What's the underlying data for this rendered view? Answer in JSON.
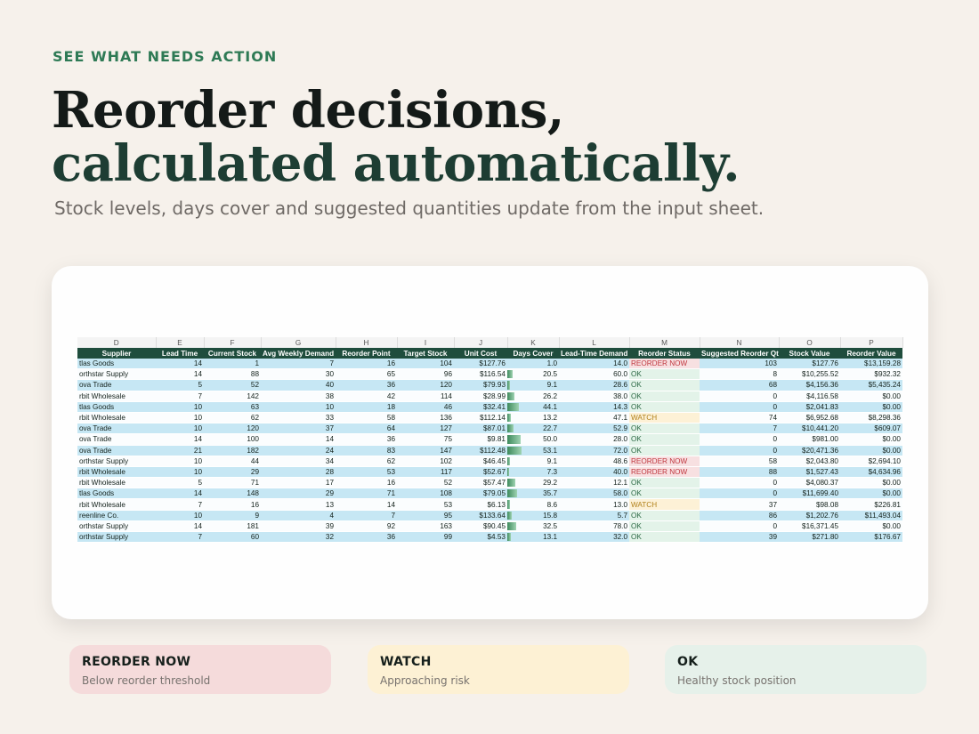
{
  "eyebrow": "SEE WHAT NEEDS ACTION",
  "headline": {
    "line1": "Reorder decisions,",
    "line2": "calculated automatically."
  },
  "subtitle": "Stock levels, days cover and suggested quantities update from the input sheet.",
  "colors": {
    "accent": "#2e7a55",
    "header_bg": "#1f4d3d",
    "row_blue": "#c6e7f4",
    "reorder": "#c0373f",
    "watch": "#b2821c",
    "ok": "#2d6a45"
  },
  "sheet": {
    "column_letters": [
      "D",
      "E",
      "F",
      "G",
      "H",
      "I",
      "J",
      "K",
      "L",
      "M",
      "N",
      "O",
      "P"
    ],
    "headers": [
      "Supplier",
      "Lead Time",
      "Current Stock",
      "Avg Weekly Demand",
      "Reorder Point",
      "Target Stock",
      "Unit Cost",
      "Days Cover",
      "Lead-Time Demand",
      "Reorder Status",
      "Suggested Reorder Qty",
      "Stock Value",
      "Reorder Value"
    ],
    "rows": [
      {
        "supplier": "tlas Goods",
        "lead": "14",
        "stock": "1",
        "demand": "7",
        "rop": "16",
        "target": "104",
        "cost": "$127.76",
        "cover": "1.0",
        "cover_pct": 0.02,
        "ltd": "14.0",
        "status": "REORDER NOW",
        "kind": "reorder",
        "qty": "103",
        "sval": "$127.76",
        "rval": "$13,159.28"
      },
      {
        "supplier": "orthstar Supply",
        "lead": "14",
        "stock": "88",
        "demand": "30",
        "rop": "65",
        "target": "96",
        "cost": "$116.54",
        "cover": "20.5",
        "cover_pct": 0.39,
        "ltd": "60.0",
        "status": "OK",
        "kind": "ok",
        "qty": "8",
        "sval": "$10,255.52",
        "rval": "$932.32"
      },
      {
        "supplier": "ova Trade",
        "lead": "5",
        "stock": "52",
        "demand": "40",
        "rop": "36",
        "target": "120",
        "cost": "$79.93",
        "cover": "9.1",
        "cover_pct": 0.17,
        "ltd": "28.6",
        "status": "OK",
        "kind": "ok",
        "qty": "68",
        "sval": "$4,156.36",
        "rval": "$5,435.24"
      },
      {
        "supplier": "rbit Wholesale",
        "lead": "7",
        "stock": "142",
        "demand": "38",
        "rop": "42",
        "target": "114",
        "cost": "$28.99",
        "cover": "26.2",
        "cover_pct": 0.49,
        "ltd": "38.0",
        "status": "OK",
        "kind": "ok",
        "qty": "0",
        "sval": "$4,116.58",
        "rval": "$0.00"
      },
      {
        "supplier": "tlas Goods",
        "lead": "10",
        "stock": "63",
        "demand": "10",
        "rop": "18",
        "target": "46",
        "cost": "$32.41",
        "cover": "44.1",
        "cover_pct": 0.83,
        "ltd": "14.3",
        "status": "OK",
        "kind": "ok",
        "qty": "0",
        "sval": "$2,041.83",
        "rval": "$0.00"
      },
      {
        "supplier": "rbit Wholesale",
        "lead": "10",
        "stock": "62",
        "demand": "33",
        "rop": "58",
        "target": "136",
        "cost": "$112.14",
        "cover": "13.2",
        "cover_pct": 0.25,
        "ltd": "47.1",
        "status": "WATCH",
        "kind": "watch",
        "qty": "74",
        "sval": "$6,952.68",
        "rval": "$8,298.36"
      },
      {
        "supplier": "ova Trade",
        "lead": "10",
        "stock": "120",
        "demand": "37",
        "rop": "64",
        "target": "127",
        "cost": "$87.01",
        "cover": "22.7",
        "cover_pct": 0.43,
        "ltd": "52.9",
        "status": "OK",
        "kind": "ok",
        "qty": "7",
        "sval": "$10,441.20",
        "rval": "$609.07"
      },
      {
        "supplier": "ova Trade",
        "lead": "14",
        "stock": "100",
        "demand": "14",
        "rop": "36",
        "target": "75",
        "cost": "$9.81",
        "cover": "50.0",
        "cover_pct": 0.94,
        "ltd": "28.0",
        "status": "OK",
        "kind": "ok",
        "qty": "0",
        "sval": "$981.00",
        "rval": "$0.00"
      },
      {
        "supplier": "ova Trade",
        "lead": "21",
        "stock": "182",
        "demand": "24",
        "rop": "83",
        "target": "147",
        "cost": "$112.48",
        "cover": "53.1",
        "cover_pct": 1.0,
        "ltd": "72.0",
        "status": "OK",
        "kind": "ok",
        "qty": "0",
        "sval": "$20,471.36",
        "rval": "$0.00"
      },
      {
        "supplier": "orthstar Supply",
        "lead": "10",
        "stock": "44",
        "demand": "34",
        "rop": "62",
        "target": "102",
        "cost": "$46.45",
        "cover": "9.1",
        "cover_pct": 0.17,
        "ltd": "48.6",
        "status": "REORDER NOW",
        "kind": "reorder",
        "qty": "58",
        "sval": "$2,043.80",
        "rval": "$2,694.10"
      },
      {
        "supplier": "rbit Wholesale",
        "lead": "10",
        "stock": "29",
        "demand": "28",
        "rop": "53",
        "target": "117",
        "cost": "$52.67",
        "cover": "7.3",
        "cover_pct": 0.14,
        "ltd": "40.0",
        "status": "REORDER NOW",
        "kind": "reorder",
        "qty": "88",
        "sval": "$1,527.43",
        "rval": "$4,634.96"
      },
      {
        "supplier": "rbit Wholesale",
        "lead": "5",
        "stock": "71",
        "demand": "17",
        "rop": "16",
        "target": "52",
        "cost": "$57.47",
        "cover": "29.2",
        "cover_pct": 0.55,
        "ltd": "12.1",
        "status": "OK",
        "kind": "ok",
        "qty": "0",
        "sval": "$4,080.37",
        "rval": "$0.00"
      },
      {
        "supplier": "tlas Goods",
        "lead": "14",
        "stock": "148",
        "demand": "29",
        "rop": "71",
        "target": "108",
        "cost": "$79.05",
        "cover": "35.7",
        "cover_pct": 0.67,
        "ltd": "58.0",
        "status": "OK",
        "kind": "ok",
        "qty": "0",
        "sval": "$11,699.40",
        "rval": "$0.00"
      },
      {
        "supplier": "rbit Wholesale",
        "lead": "7",
        "stock": "16",
        "demand": "13",
        "rop": "14",
        "target": "53",
        "cost": "$6.13",
        "cover": "8.6",
        "cover_pct": 0.16,
        "ltd": "13.0",
        "status": "WATCH",
        "kind": "watch",
        "qty": "37",
        "sval": "$98.08",
        "rval": "$226.81"
      },
      {
        "supplier": "reenline Co.",
        "lead": "10",
        "stock": "9",
        "demand": "4",
        "rop": "7",
        "target": "95",
        "cost": "$133.64",
        "cover": "15.8",
        "cover_pct": 0.3,
        "ltd": "5.7",
        "status": "OK",
        "kind": "ok",
        "qty": "86",
        "sval": "$1,202.76",
        "rval": "$11,493.04"
      },
      {
        "supplier": "orthstar Supply",
        "lead": "14",
        "stock": "181",
        "demand": "39",
        "rop": "92",
        "target": "163",
        "cost": "$90.45",
        "cover": "32.5",
        "cover_pct": 0.61,
        "ltd": "78.0",
        "status": "OK",
        "kind": "ok",
        "qty": "0",
        "sval": "$16,371.45",
        "rval": "$0.00"
      },
      {
        "supplier": "orthstar Supply",
        "lead": "7",
        "stock": "60",
        "demand": "32",
        "rop": "36",
        "target": "99",
        "cost": "$4.53",
        "cover": "13.1",
        "cover_pct": 0.25,
        "ltd": "32.0",
        "status": "OK",
        "kind": "ok",
        "qty": "39",
        "sval": "$271.80",
        "rval": "$176.67"
      }
    ]
  },
  "legend": [
    {
      "title": "REORDER NOW",
      "desc": "Below reorder threshold"
    },
    {
      "title": "WATCH",
      "desc": "Approaching risk"
    },
    {
      "title": "OK",
      "desc": "Healthy stock position"
    }
  ]
}
